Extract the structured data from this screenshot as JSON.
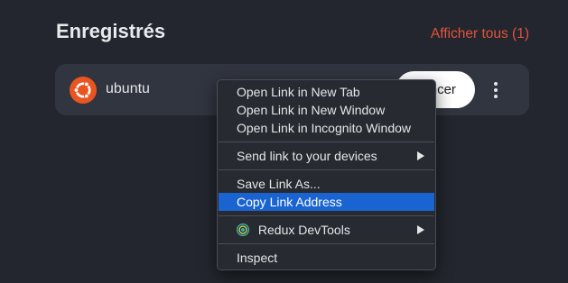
{
  "section": {
    "title": "Enregistrés",
    "show_all": "Afficher tous (1)"
  },
  "card": {
    "label": "ubuntu",
    "icon": "ubuntu-logo-icon",
    "launch_label": "Lancer",
    "more_icon": "more-vertical-icon"
  },
  "context_menu": {
    "open_new_tab": "Open Link in New Tab",
    "open_new_window": "Open Link in New Window",
    "open_incognito": "Open Link in Incognito Window",
    "send_link": "Send link to your devices",
    "save_link_as": "Save Link As...",
    "copy_link_address": "Copy Link Address",
    "redux_devtools": "Redux DevTools",
    "inspect": "Inspect"
  },
  "colors": {
    "background": "#23262e",
    "card": "#31353f",
    "accent": "#e2533a",
    "menu_highlight": "#1a64d2",
    "ubuntu_orange": "#e95420"
  }
}
